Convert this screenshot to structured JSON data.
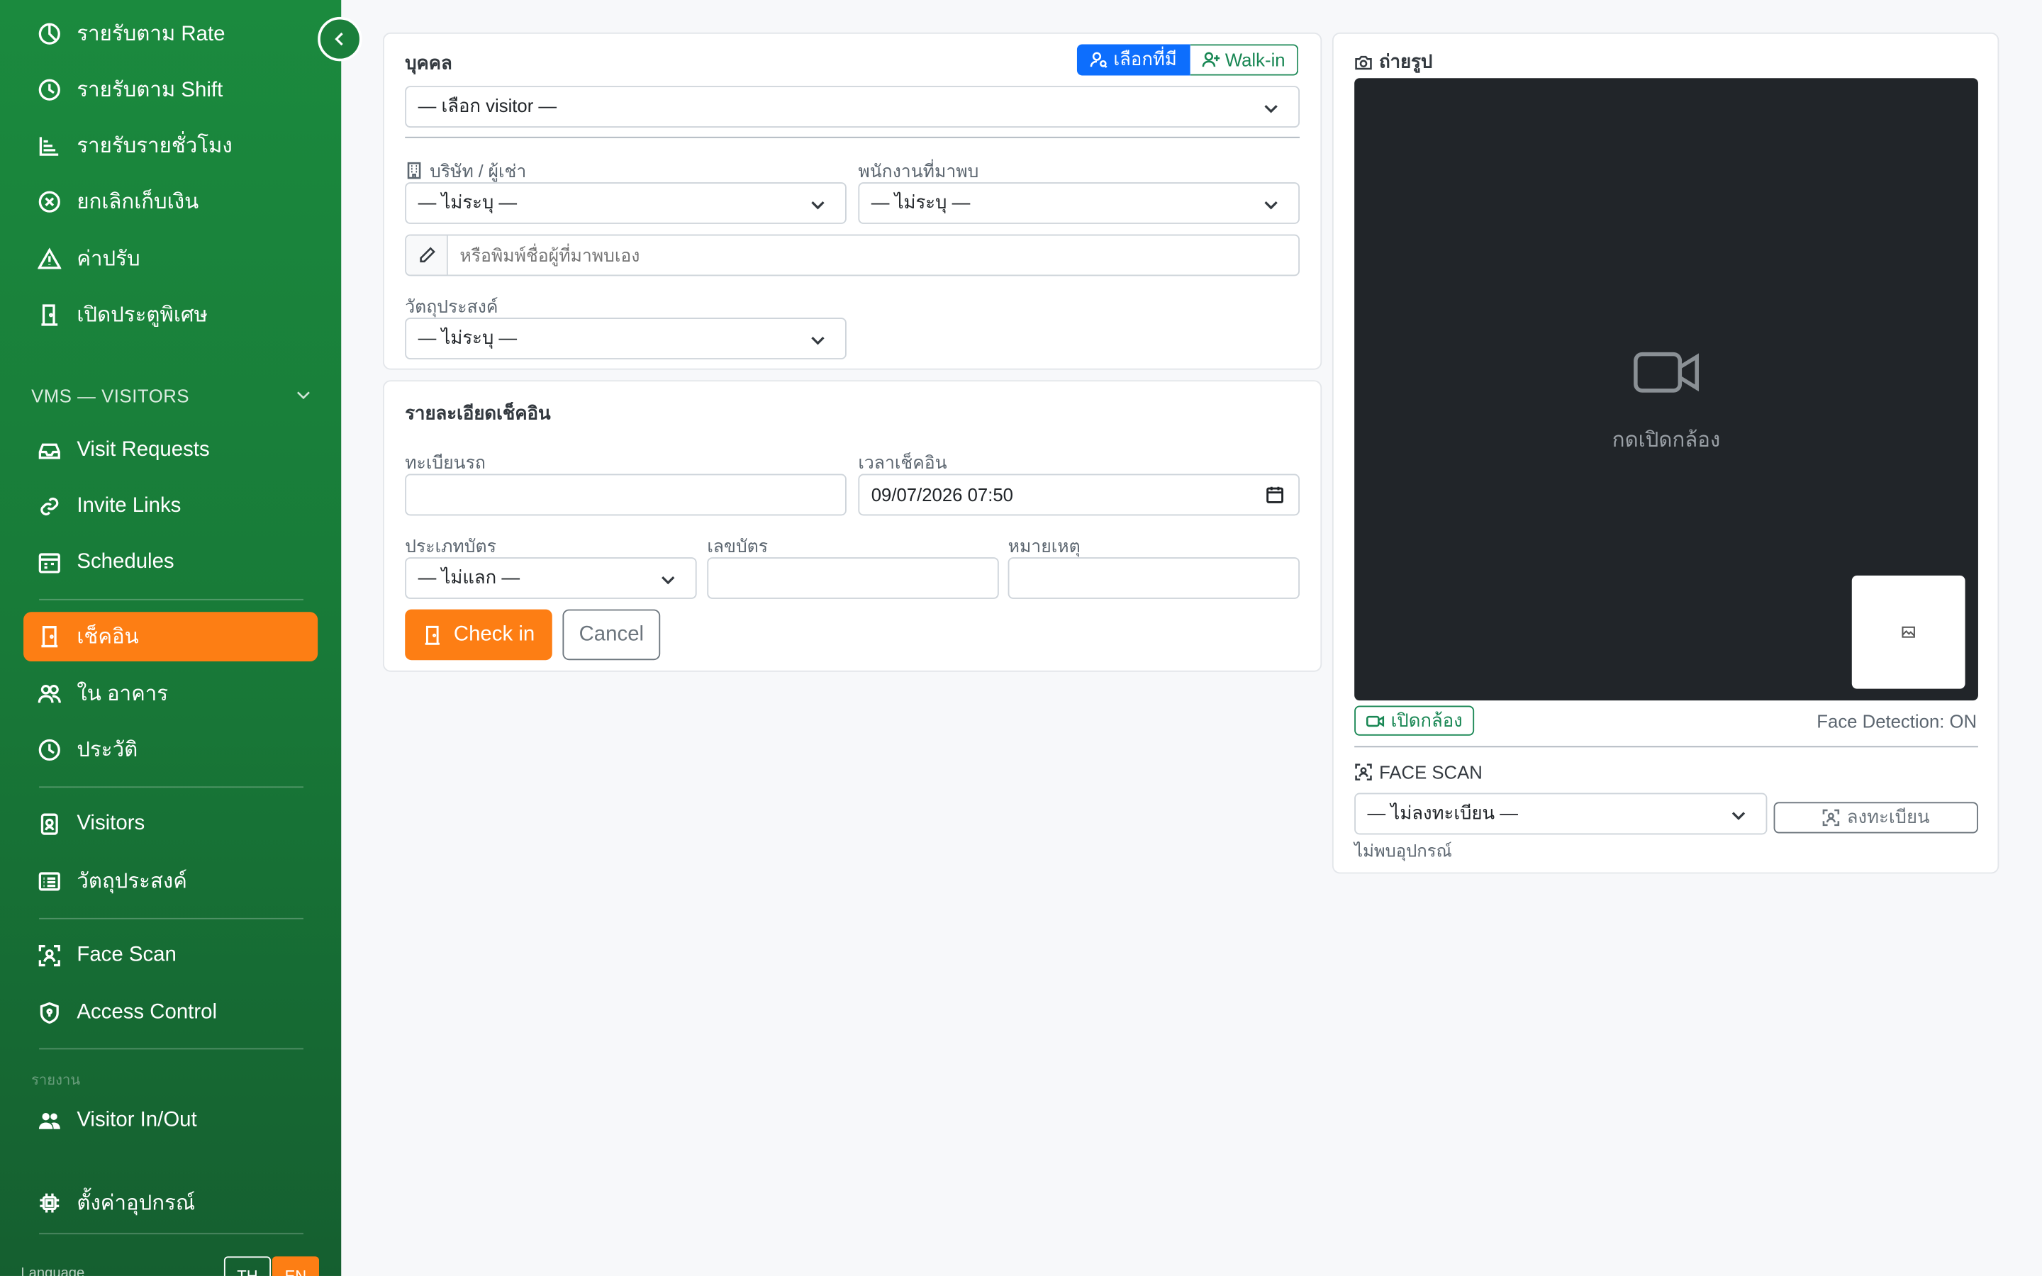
{
  "sidebar": {
    "items": [
      {
        "label": "รายรับตาม Rate",
        "icon": "pie-chart-icon"
      },
      {
        "label": "รายรับตาม Shift",
        "icon": "clock-icon"
      },
      {
        "label": "รายรับรายชั่วโมง",
        "icon": "bar-list-icon"
      },
      {
        "label": "ยกเลิกเก็บเงิน",
        "icon": "x-circle-icon"
      },
      {
        "label": "ค่าปรับ",
        "icon": "warning-triangle-icon"
      },
      {
        "label": "เปิดประตูพิเศษ",
        "icon": "door-icon"
      }
    ],
    "section_vms": "VMS — VISITORS",
    "vms_items": [
      {
        "label": "Visit Requests",
        "icon": "inbox-icon"
      },
      {
        "label": "Invite Links",
        "icon": "link-icon"
      },
      {
        "label": "Schedules",
        "icon": "calendar-icon"
      }
    ],
    "checkin_items": [
      {
        "label": "เช็คอิน",
        "icon": "door-open-icon",
        "active": true
      },
      {
        "label": "ใน อาคาร",
        "icon": "people-icon"
      },
      {
        "label": "ประวัติ",
        "icon": "history-icon"
      }
    ],
    "master_items": [
      {
        "label": "Visitors",
        "icon": "person-badge-icon"
      },
      {
        "label": "วัตถุประสงค์",
        "icon": "card-list-icon"
      }
    ],
    "device_items": [
      {
        "label": "Face Scan",
        "icon": "face-scan-icon"
      },
      {
        "label": "Access Control",
        "icon": "shield-icon"
      }
    ],
    "report_caption": "รายงาน",
    "report_items": [
      {
        "label": "Visitor In/Out",
        "icon": "people-fill-icon"
      }
    ],
    "settings_item": {
      "label": "ตั้งค่าอุปกรณ์",
      "icon": "cpu-icon"
    },
    "language_label": "Language",
    "lang_th": "TH",
    "lang_en": "EN"
  },
  "person_card": {
    "title": "บุคคล",
    "toggle_existing": "เลือกที่มี",
    "toggle_walkin": "Walk-in",
    "visitor_select": "— เลือก visitor —",
    "company_label": "บริษัท / ผู้เช่า",
    "company_value": "— ไม่ระบุ —",
    "host_label": "พนักงานที่มาพบ",
    "host_value": "— ไม่ระบุ —",
    "host_manual_placeholder": "หรือพิมพ์ชื่อผู้ที่มาพบเอง",
    "purpose_label": "วัตถุประสงค์",
    "purpose_value": "— ไม่ระบุ —"
  },
  "checkin_card": {
    "title": "รายละเอียดเช็คอิน",
    "plate_label": "ทะเบียนรถ",
    "plate_value": "",
    "time_label": "เวลาเช็คอิน",
    "time_value": "09/07/2026 07:50",
    "card_type_label": "ประเภทบัตร",
    "card_type_value": "— ไม่แลก —",
    "card_no_label": "เลขบัตร",
    "card_no_value": "",
    "note_label": "หมายเหตุ",
    "note_value": "",
    "checkin_button": "Check in",
    "cancel_button": "Cancel"
  },
  "photo_card": {
    "title": "ถ่ายรูป",
    "camera_placeholder": "กดเปิดกล้อง",
    "open_camera_button": "เปิดกล้อง",
    "face_detection_status": "Face Detection: ON",
    "face_scan_title": "FACE SCAN",
    "face_scan_select": "— ไม่ลงทะเบียน —",
    "register_button": "ลงทะเบียน",
    "device_status": "ไม่พบอุปกรณ์"
  },
  "colors": {
    "sidebar_green": "#1b8a3e",
    "accent_orange": "#fd7e14",
    "primary_blue": "#0d6efd",
    "success_green": "#198754",
    "camera_bg": "#212529"
  }
}
